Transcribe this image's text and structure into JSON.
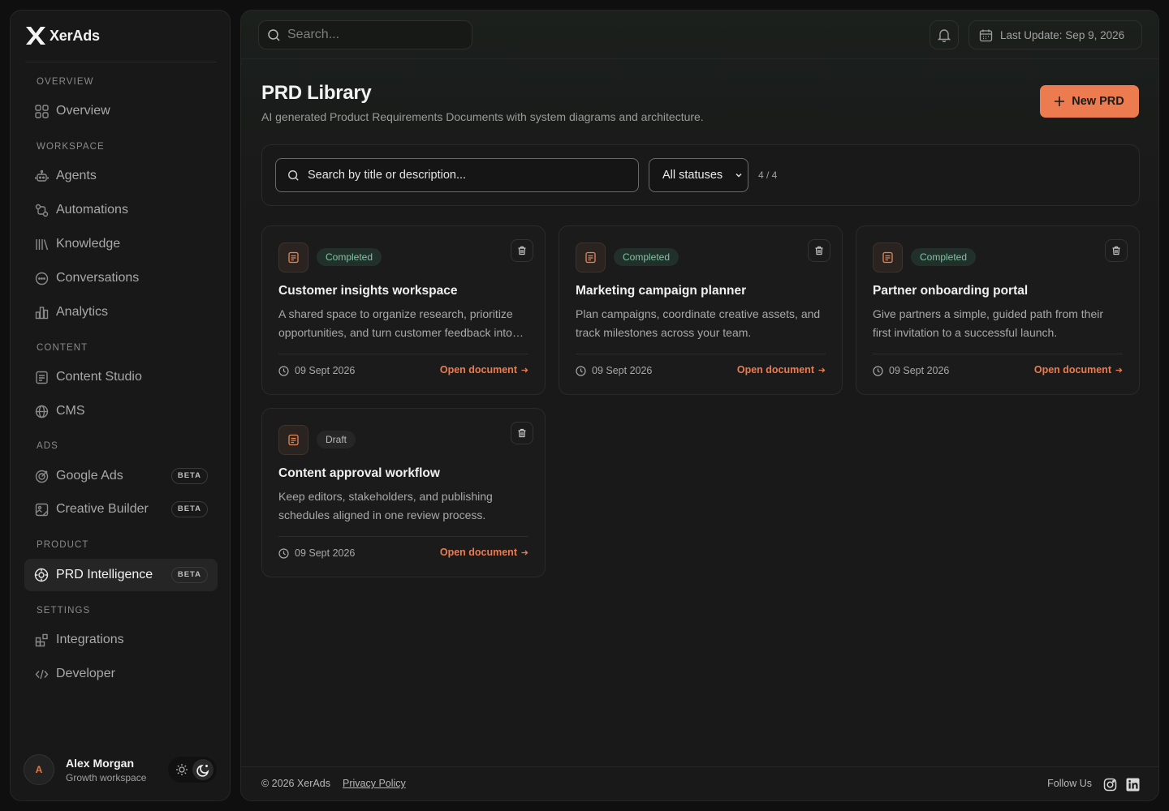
{
  "brand": {
    "name": "XerAds"
  },
  "sidebar": {
    "sections": [
      {
        "label": "OVERVIEW",
        "items": [
          {
            "label": "Overview",
            "icon": "grid-icon"
          }
        ]
      },
      {
        "label": "WORKSPACE",
        "items": [
          {
            "label": "Agents",
            "icon": "robot-icon"
          },
          {
            "label": "Automations",
            "icon": "workflow-icon"
          },
          {
            "label": "Knowledge",
            "icon": "library-icon"
          },
          {
            "label": "Conversations",
            "icon": "chat-icon"
          },
          {
            "label": "Analytics",
            "icon": "bar-chart-icon"
          }
        ]
      },
      {
        "label": "CONTENT",
        "items": [
          {
            "label": "Content Studio",
            "icon": "document-icon"
          },
          {
            "label": "CMS",
            "icon": "globe-icon"
          }
        ]
      },
      {
        "label": "ADS",
        "items": [
          {
            "label": "Google Ads",
            "icon": "target-icon",
            "badge": "BETA"
          },
          {
            "label": "Creative Builder",
            "icon": "image-edit-icon",
            "badge": "BETA"
          }
        ]
      },
      {
        "label": "PRODUCT",
        "items": [
          {
            "label": "PRD Intelligence",
            "icon": "cog-spark-icon",
            "badge": "BETA",
            "active": true
          }
        ]
      },
      {
        "label": "SETTINGS",
        "items": [
          {
            "label": "Integrations",
            "icon": "puzzle-icon"
          },
          {
            "label": "Developer",
            "icon": "code-icon"
          }
        ]
      }
    ]
  },
  "user": {
    "initial": "A",
    "name": "Alex Morgan",
    "workspace": "Growth workspace"
  },
  "topbar": {
    "search_placeholder": "Search...",
    "last_update": "Last Update: Sep 9, 2026"
  },
  "page": {
    "title": "PRD Library",
    "subtitle": "AI generated Product Requirements Documents with system diagrams and architecture.",
    "new_button": "New PRD"
  },
  "filters": {
    "search_placeholder": "Search by title or description...",
    "status_selected": "All statuses",
    "count": "4 / 4"
  },
  "cards": [
    {
      "status": "Completed",
      "title": "Customer insights workspace",
      "description": "A shared space to organize research, prioritize opportunities, and turn customer feedback into action.",
      "date": "09 Sept 2026",
      "link": "Open document"
    },
    {
      "status": "Completed",
      "title": "Marketing campaign planner",
      "description": "Plan campaigns, coordinate creative assets, and track milestones across your team.",
      "date": "09 Sept 2026",
      "link": "Open document"
    },
    {
      "status": "Completed",
      "title": "Partner onboarding portal",
      "description": "Give partners a simple, guided path from their first invitation to a successful launch.",
      "date": "09 Sept 2026",
      "link": "Open document"
    },
    {
      "status": "Draft",
      "title": "Content approval workflow",
      "description": "Keep editors, stakeholders, and publishing schedules aligned in one review process.",
      "date": "09 Sept 2026",
      "link": "Open document"
    }
  ],
  "footer": {
    "copyright": "© 2026 XerAds",
    "privacy": "Privacy Policy",
    "follow": "Follow Us"
  },
  "colors": {
    "accent": "#ec7b4f",
    "completed_text": "#7fc4a2",
    "background": "#0f0f0f"
  }
}
